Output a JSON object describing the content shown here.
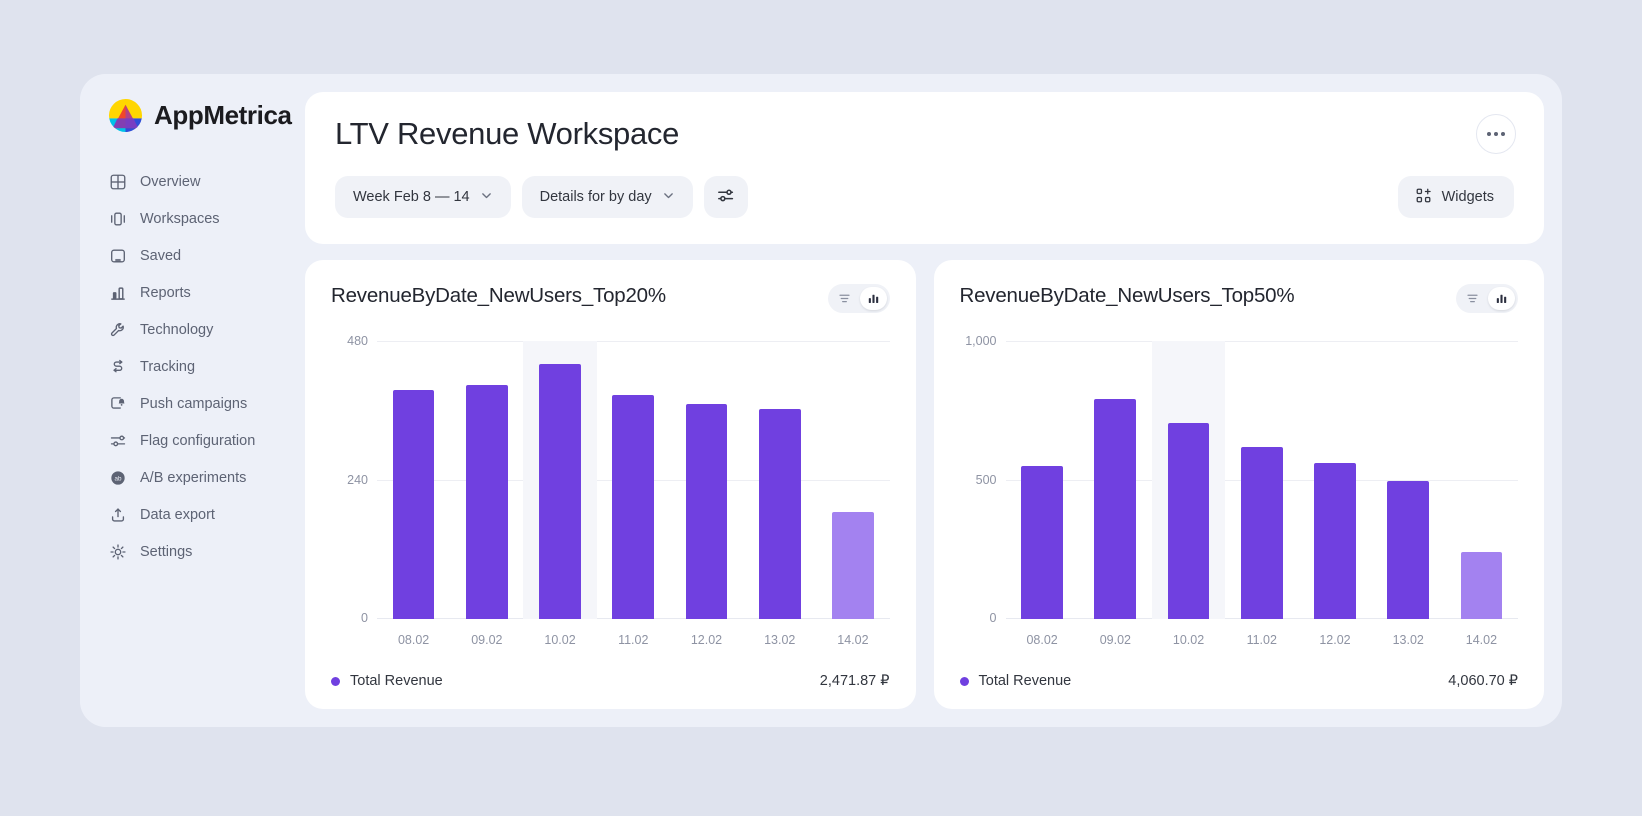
{
  "brand": {
    "name": "AppMetrica",
    "logo_icon": "appmetrica-logo-icon"
  },
  "sidebar": {
    "items": [
      {
        "label": "Overview",
        "icon": "grid-icon"
      },
      {
        "label": "Workspaces",
        "icon": "workspaces-icon"
      },
      {
        "label": "Saved",
        "icon": "bookmark-panel-icon"
      },
      {
        "label": "Reports",
        "icon": "bar-chart-icon"
      },
      {
        "label": "Technology",
        "icon": "wrench-icon"
      },
      {
        "label": "Tracking",
        "icon": "tracking-path-icon"
      },
      {
        "label": "Push campaigns",
        "icon": "push-bell-icon"
      },
      {
        "label": "Flag configuration",
        "icon": "sliders-icon"
      },
      {
        "label": "A/B experiments",
        "icon": "ab-circle-icon"
      },
      {
        "label": "Data export",
        "icon": "upload-icon"
      },
      {
        "label": "Settings",
        "icon": "gear-icon"
      }
    ]
  },
  "header": {
    "title": "LTV Revenue Workspace",
    "more_icon": "ellipsis-icon",
    "filters": {
      "period": {
        "label": "Week Feb 8 — 14",
        "chevron_icon": "chevron-down-icon"
      },
      "details": {
        "label": "Details for by day",
        "chevron_icon": "chevron-down-icon"
      },
      "settings": {
        "icon": "sliders-icon",
        "label": ""
      }
    },
    "widgets_button": {
      "label": "Widgets",
      "icon": "widgets-grid-plus-icon"
    }
  },
  "colors": {
    "accent": "#7040e0",
    "accent_faded": "#a382f0",
    "card_bg": "#ffffff",
    "app_bg": "#edf0f8",
    "page_bg": "#dfe3ee"
  },
  "cards": [
    {
      "title": "RevenueByDate_NewUsers_Top20%",
      "view_toggle": {
        "table_icon": "table-view-icon",
        "chart_icon": "bar-chart-view-icon",
        "active": "chart"
      },
      "legend_label": "Total Revenue",
      "total": "2,471.87 ₽"
    },
    {
      "title": "RevenueByDate_NewUsers_Top50%",
      "view_toggle": {
        "table_icon": "table-view-icon",
        "chart_icon": "bar-chart-view-icon",
        "active": "chart"
      },
      "legend_label": "Total Revenue",
      "total": "4,060.70 ₽"
    }
  ],
  "chart_data": [
    {
      "type": "bar",
      "title": "RevenueByDate_NewUsers_Top20%",
      "xlabel": "",
      "ylabel": "",
      "categories": [
        "08.02",
        "09.02",
        "10.02",
        "11.02",
        "12.02",
        "13.02",
        "14.02"
      ],
      "series": [
        {
          "name": "Total Revenue",
          "values": [
            395,
            403,
            440,
            387,
            372,
            363,
            185
          ]
        }
      ],
      "ylim": [
        0,
        480
      ],
      "yticks": [
        0,
        240,
        480
      ],
      "ytick_labels": [
        "0",
        "240",
        "480"
      ],
      "grid": true,
      "legend_position": "bottom-left",
      "highlighted_category": "10.02",
      "faded_bars": [
        "14.02"
      ],
      "total_label": "Total Revenue",
      "total_value": "2,471.87 ₽"
    },
    {
      "type": "bar",
      "title": "RevenueByDate_NewUsers_Top50%",
      "xlabel": "",
      "ylabel": "",
      "categories": [
        "08.02",
        "09.02",
        "10.02",
        "11.02",
        "12.02",
        "13.02",
        "14.02"
      ],
      "series": [
        {
          "name": "Total Revenue",
          "values": [
            550,
            790,
            705,
            620,
            563,
            498,
            242
          ]
        }
      ],
      "ylim": [
        0,
        1000
      ],
      "yticks": [
        0,
        500,
        1000
      ],
      "ytick_labels": [
        "0",
        "500",
        "1,000"
      ],
      "grid": true,
      "legend_position": "bottom-left",
      "highlighted_category": "10.02",
      "faded_bars": [
        "14.02"
      ],
      "total_label": "Total Revenue",
      "total_value": "4,060.70 ₽"
    }
  ]
}
